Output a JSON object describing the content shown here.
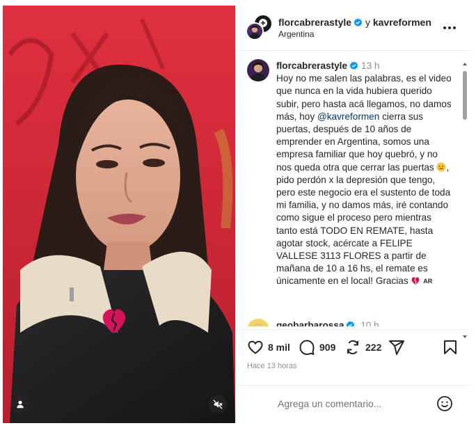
{
  "header": {
    "owner": "florcabrerastyle",
    "connector": "y",
    "collaborator": "kavreformen",
    "location": "Argentina"
  },
  "caption": {
    "username": "florcabrerastyle",
    "time": "13 h",
    "text_1": "Hoy no me salen las palabras, es el video que nunca en la vida hubiera querido subir, pero hasta acá llegamos, no damos más, hoy ",
    "mention": "@kavreformen",
    "text_2": " cierra sus puertas, después de 10 años de emprender en Argentina, somos una empresa familiar que hoy quebró, y no nos queda otra que cerrar las puertas ",
    "text_3": ", pido perdón x la depresión que tengo, pero este negocio era el sustento de toda mi familia, y no damos más, iré contando como sigue el proceso pero mientras tanto está TODO EN REMATE, hasta agotar stock, acércate a FELIPE VALLESE 3113 FLORES a partir de mañana de 10 a 16 hs, el remate es únicamente en el local! Gracias ",
    "flag": "AR"
  },
  "comment2": {
    "username": "geobarbarossa",
    "time": "10 h"
  },
  "actions": {
    "likes": "8 mil",
    "comments": "909",
    "shares": "222"
  },
  "timestamp": "Hace 13 horas",
  "composer": {
    "placeholder": "Agrega un comentario..."
  },
  "colors": {
    "verified": "#0095f6",
    "mention": "#00376b",
    "heart_broken": "#d4145a",
    "video_bg": "#d42a3a"
  },
  "icons": [
    "heart-icon",
    "comment-icon",
    "share-icon",
    "send-icon",
    "save-icon",
    "emoji-icon",
    "user-tag-icon",
    "mute-icon",
    "more-icon",
    "verified-icon",
    "broken-heart-icon"
  ]
}
